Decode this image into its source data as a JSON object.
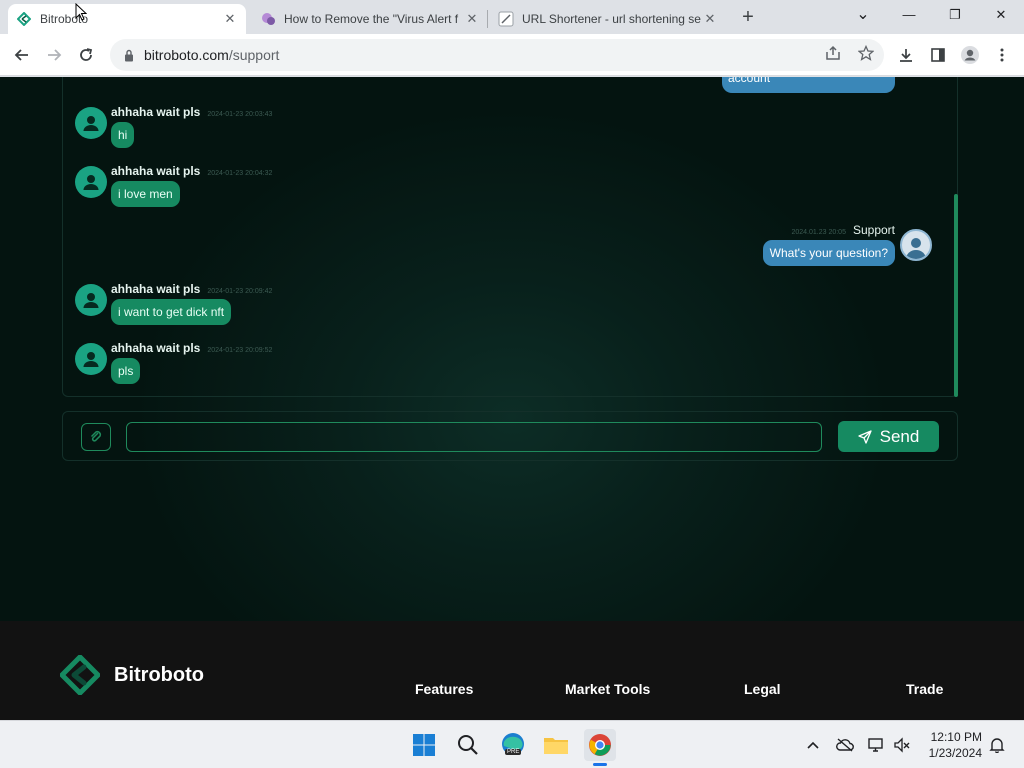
{
  "browser": {
    "tabs": [
      {
        "title": "Bitroboto",
        "close": "✕"
      },
      {
        "title": "How to Remove the \"Virus Alert f",
        "close": "✕"
      },
      {
        "title": "URL Shortener - url shortening se",
        "close": "✕"
      }
    ],
    "new_tab": "+",
    "window_controls": {
      "dropdown": "⌄",
      "minimize": "—",
      "maximize": "❐",
      "close": "✕"
    },
    "url_host": "bitroboto.com",
    "url_path": "/support"
  },
  "chat": {
    "partial_bubble_text": "account",
    "messages": [
      {
        "author": "ahhaha wait pls",
        "time": "2024-01-23 20:03:43",
        "text": "hi",
        "side": "left"
      },
      {
        "author": "ahhaha wait pls",
        "time": "2024-01-23 20:04:32",
        "text": "i love men",
        "side": "left"
      },
      {
        "author": "Support",
        "time": "2024.01.23 20:05",
        "text": "What's your question?",
        "side": "right"
      },
      {
        "author": "ahhaha wait pls",
        "time": "2024-01-23 20:09:42",
        "text": "i want to get dick nft",
        "side": "left"
      },
      {
        "author": "ahhaha wait pls",
        "time": "2024-01-23 20:09:52",
        "text": "pls",
        "side": "left"
      }
    ],
    "input_value": "",
    "send_label": "Send"
  },
  "footer": {
    "brand": "Bitroboto",
    "nav": [
      "Features",
      "Market Tools",
      "Legal",
      "Trade"
    ]
  },
  "taskbar": {
    "time": "12:10 PM",
    "date": "1/23/2024",
    "edge_badge": "PRE"
  },
  "colors": {
    "accent_green": "#168a61",
    "support_blue": "#3a87b8",
    "page_bg": "#041410"
  }
}
